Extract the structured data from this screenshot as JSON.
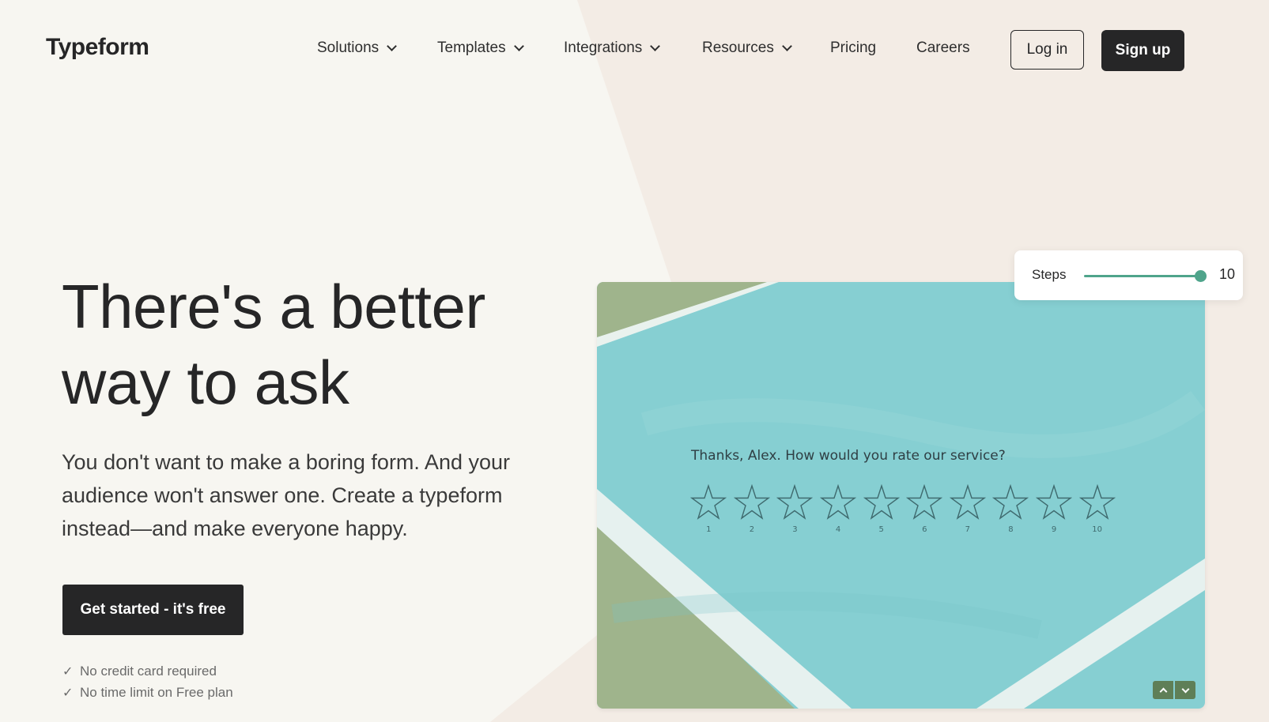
{
  "brand": {
    "logo": "Typeform"
  },
  "nav": {
    "items": [
      {
        "label": "Solutions",
        "dropdown": true
      },
      {
        "label": "Templates",
        "dropdown": true
      },
      {
        "label": "Integrations",
        "dropdown": true
      },
      {
        "label": "Resources",
        "dropdown": true
      },
      {
        "label": "Pricing",
        "dropdown": false
      },
      {
        "label": "Careers",
        "dropdown": false
      }
    ],
    "login_label": "Log in",
    "signup_label": "Sign up"
  },
  "hero": {
    "title_line1": "There's a better",
    "title_line2": "way to ask",
    "subtitle": "You don't want to make a boring form. And your audience won't answer one. Create a typeform instead—and make everyone happy.",
    "cta_label": "Get started - it's free",
    "checks": [
      "No credit card required",
      "No time limit on Free plan"
    ],
    "check_glyph": "✓"
  },
  "preview": {
    "question": "Thanks, Alex. How would you rate our service?",
    "rating_labels": [
      "1",
      "2",
      "3",
      "4",
      "5",
      "6",
      "7",
      "8",
      "9",
      "10"
    ],
    "pager": {
      "up_icon": "chevron-up-icon",
      "down_icon": "chevron-down-icon"
    }
  },
  "steps_widget": {
    "label": "Steps",
    "value": "10",
    "slider_fraction": 1.0
  },
  "colors": {
    "ink": "#262627",
    "page_bg": "#f7f6f1",
    "accent_shape": "#f3ece5",
    "preview_teal": "#86cfd2",
    "preview_olive": "#9fb48c",
    "slider_green": "#4fa48b"
  }
}
